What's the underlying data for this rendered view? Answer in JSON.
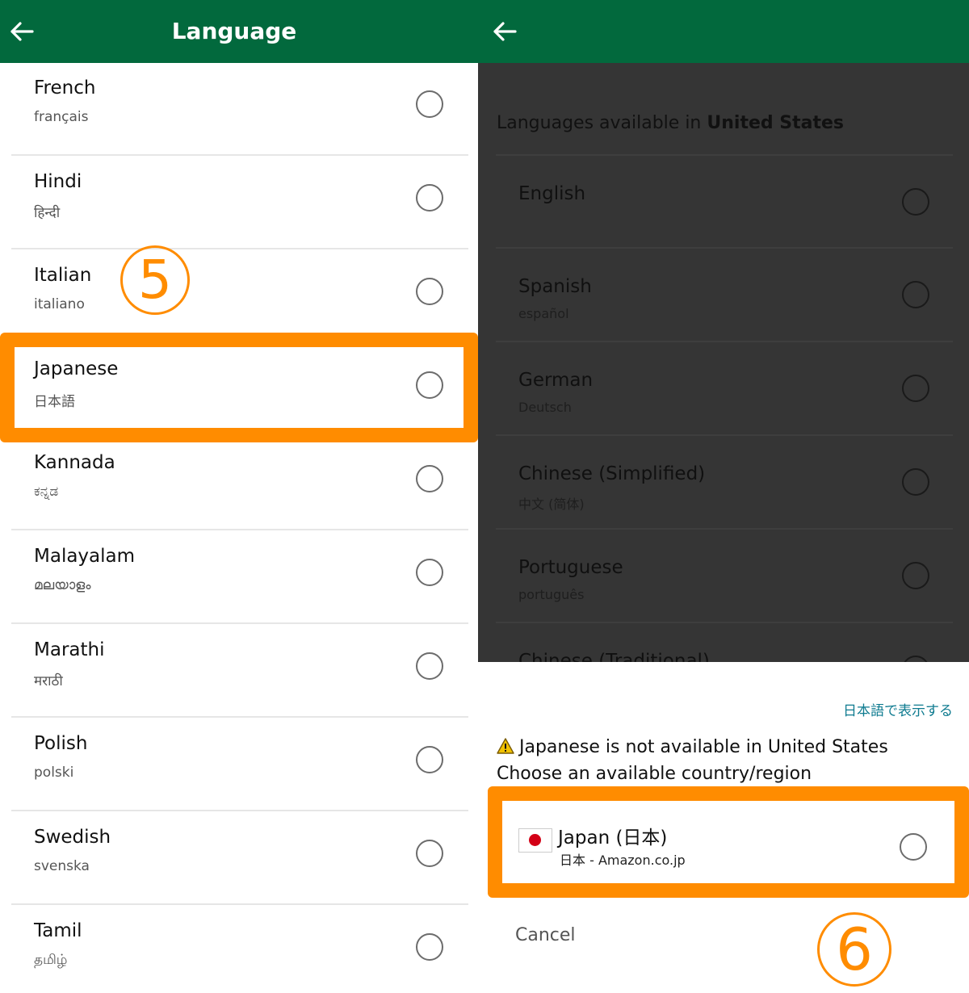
{
  "left": {
    "title": "Language",
    "languages": [
      {
        "name": "French",
        "native": "français"
      },
      {
        "name": "Hindi",
        "native": "हिन्दी"
      },
      {
        "name": "Italian",
        "native": "italiano"
      },
      {
        "name": "Japanese",
        "native": "日本語"
      },
      {
        "name": "Kannada",
        "native": "ಕನ್ನಡ"
      },
      {
        "name": "Malayalam",
        "native": "മലയാളം"
      },
      {
        "name": "Marathi",
        "native": "मराठी"
      },
      {
        "name": "Polish",
        "native": "polski"
      },
      {
        "name": "Swedish",
        "native": "svenska"
      },
      {
        "name": "Tamil",
        "native": "தமிழ்"
      }
    ],
    "step_marker": "5"
  },
  "right": {
    "heading_prefix": "Languages available in ",
    "heading_country": "United States",
    "languages": [
      {
        "name": "English",
        "native": ""
      },
      {
        "name": "Spanish",
        "native": "español"
      },
      {
        "name": "German",
        "native": "Deutsch"
      },
      {
        "name": "Chinese (Simplified)",
        "native": "中文 (简体)"
      },
      {
        "name": "Portuguese",
        "native": "português"
      },
      {
        "name": "Chinese (Traditional)",
        "native": ""
      }
    ],
    "sheet": {
      "jp_link": "日本語で表示する",
      "warning": "Japanese is not available in United States",
      "choose": "Choose an available country/region",
      "country_name": "Japan (日本)",
      "country_sub": "日本 - Amazon.co.jp",
      "cancel": "Cancel"
    },
    "step_marker": "6"
  },
  "colors": {
    "app_bar": "#02693d",
    "highlight": "#ff8c00",
    "overlay": "#353535",
    "link": "#0f7b90"
  },
  "icons": {
    "back": "arrow-left-icon",
    "warning": "warning-triangle-icon",
    "flag": "japan-flag-icon"
  }
}
